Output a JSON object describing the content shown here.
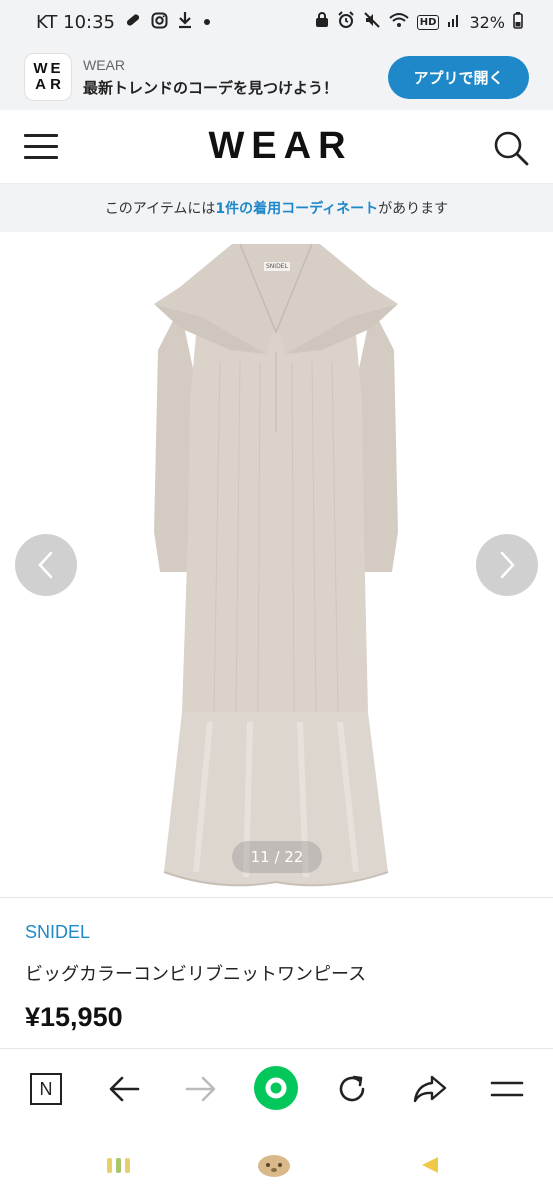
{
  "status_bar": {
    "carrier_time": "KT 10:35",
    "battery": "32%",
    "hd": "HD"
  },
  "banner": {
    "logo_row1_a": "W",
    "logo_row1_b": "E",
    "logo_row2_a": "A",
    "logo_row2_b": "R",
    "app_name": "WEAR",
    "tagline": "最新トレンドのコーデを見つけよう！",
    "open_app_label": "アプリで開く"
  },
  "header": {
    "logo": "WEAR"
  },
  "coordinate_notice": {
    "prefix": "このアイテムには",
    "highlight": "1件の着用コーディネート",
    "suffix": "があります"
  },
  "gallery": {
    "counter": "11 / 22",
    "tag_label": "SNIDEL"
  },
  "product": {
    "brand": "SNIDEL",
    "name": "ビッグカラーコンビリブニットワンピース",
    "price": "¥15,950"
  },
  "browser_bar": {
    "n_icon": "N"
  },
  "colors": {
    "accent": "#1e88c9",
    "naver_green": "#03c75a",
    "dress_knit": "#d9d1c8",
    "dress_satin": "#ddd6cf"
  }
}
